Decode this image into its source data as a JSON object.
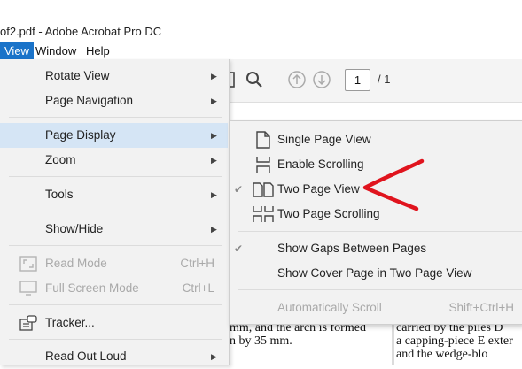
{
  "window": {
    "title": "of2.pdf - Adobe Acrobat Pro DC"
  },
  "menubar": {
    "items": [
      {
        "label": "View",
        "active": true
      },
      {
        "label": "Window",
        "active": false
      },
      {
        "label": "Help",
        "active": false
      }
    ]
  },
  "toolbar": {
    "page_number": "1",
    "page_total": "/ 1",
    "icons": [
      "sidebar-toggle-icon",
      "search-icon",
      "previous-page-icon",
      "next-page-icon"
    ]
  },
  "view_menu": {
    "items": [
      {
        "label": "Rotate View",
        "submenu": true
      },
      {
        "label": "Page Navigation",
        "submenu": true
      },
      {
        "label": "Page Display",
        "submenu": true,
        "highlighted": true
      },
      {
        "label": "Zoom",
        "submenu": true
      },
      {
        "label": "Tools",
        "submenu": true
      },
      {
        "label": "Show/Hide",
        "submenu": true
      },
      {
        "label": "Read Mode",
        "shortcut": "Ctrl+H",
        "disabled": true,
        "icon": "read-mode-icon"
      },
      {
        "label": "Full Screen Mode",
        "shortcut": "Ctrl+L",
        "disabled": true,
        "icon": "full-screen-icon"
      },
      {
        "label": "Tracker...",
        "icon": "tracker-icon"
      },
      {
        "label": "Read Out Loud",
        "submenu": true
      }
    ]
  },
  "page_display_submenu": {
    "items": [
      {
        "label": "Single Page View",
        "icon": "single-page-icon",
        "checked": false
      },
      {
        "label": "Enable Scrolling",
        "icon": "scrolling-icon",
        "checked": false
      },
      {
        "label": "Two Page View",
        "icon": "two-page-icon",
        "checked": true
      },
      {
        "label": "Two Page Scrolling",
        "icon": "two-page-scrolling-icon",
        "checked": false
      },
      {
        "label": "Show Gaps Between Pages",
        "checked": true
      },
      {
        "label": "Show Cover Page in Two Page View",
        "checked": false
      },
      {
        "label": "Automatically Scroll",
        "shortcut": "Shift+Ctrl+H",
        "disabled": true
      }
    ]
  },
  "document": {
    "left_column": [
      "mm, and the arch is formed",
      "n by 35 mm."
    ],
    "right_column": [
      "carried by the piles D",
      "a capping-piece E exter",
      "and  the  wedge-blo"
    ]
  },
  "colors": {
    "menu_active": "#1a73c9",
    "menu_background": "#f2f2f2",
    "hover_highlight": "#d5e5f5",
    "annotation_red": "#e0141e"
  }
}
